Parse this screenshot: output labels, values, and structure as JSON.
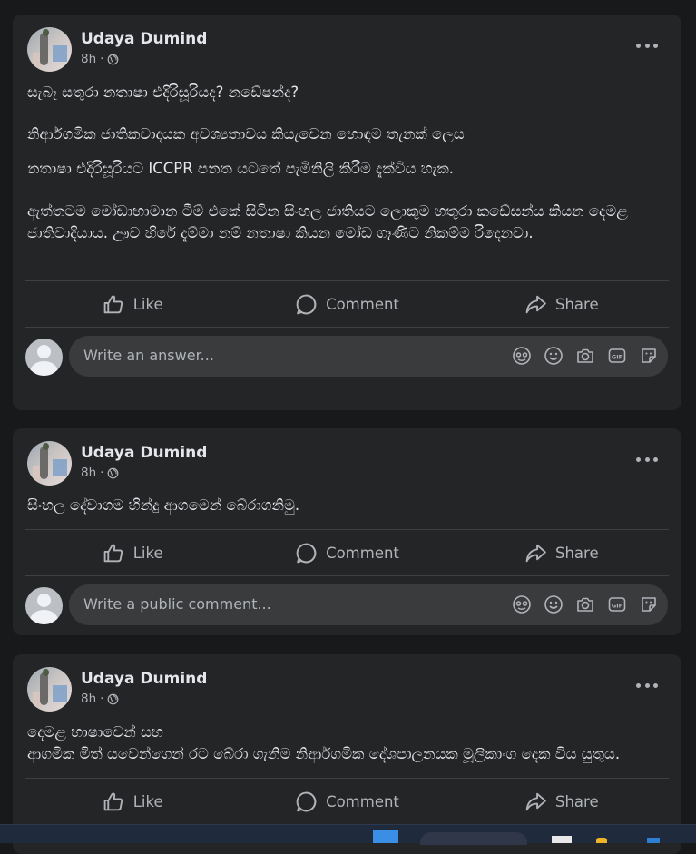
{
  "posts": [
    {
      "author": "Udaya Dumind",
      "time": "8h",
      "separator": "·",
      "paragraphs": [
        "සැබෑ සතුරා නතාෂා එදිරිසූරියද? නඩේෂන්ද?",
        "නිර්ආගමික ජාතිකවාදයක අවශ්‍යතාවය කියැවෙන හොඳම තැනක් ලෙස",
        "නතාෂා එදිරිසූරියට ICCPR පනත යටතේ පැමිනිලි කිරීම දැක්විය හැක.",
        "ඇත්තටම මෝඩාභාමාන ටීම් එකේ සිටින සිංහල ජාතියට ලොකුම හතුරා කඩේසන්ය කියන දෙමළ ජාතිවාදියාය. ඌව හිරේ දැම්මා නම් නතාෂා කියන මෝඩ ගෑණිට නිකම්ම රිදෙනවා."
      ],
      "actions": {
        "like": "Like",
        "comment": "Comment",
        "share": "Share"
      },
      "comment_placeholder": "Write an answer..."
    },
    {
      "author": "Udaya Dumind",
      "time": "8h",
      "separator": "·",
      "paragraphs": [
        "සිංහල දේවාගම හින්දු ආගමෙන් බේරාගනිමු."
      ],
      "actions": {
        "like": "Like",
        "comment": "Comment",
        "share": "Share"
      },
      "comment_placeholder": "Write a public comment..."
    },
    {
      "author": "Udaya Dumind",
      "time": "8h",
      "separator": "·",
      "paragraphs": [
        "දෙමළ භාෂාවෙන් සහ\nආගමික මිත් යවෙන්ගෙන් රට බේරා ගැනිම නිර්ආගමික දේශපාලනයක මූලිකාංග දෙක විය යුතුය."
      ],
      "actions": {
        "like": "Like",
        "comment": "Comment",
        "share": "Share"
      }
    }
  ],
  "icons": [
    "globe-icon",
    "more-icon",
    "like-icon",
    "comment-icon",
    "share-icon",
    "avatar-frame-icon",
    "emoji-icon",
    "camera-icon",
    "gif-icon",
    "sticker-icon"
  ],
  "colors": {
    "background": "#18191a",
    "card": "#242526",
    "input": "#3a3b3c",
    "text": "#e4e6eb",
    "secondary": "#b0b3b8"
  }
}
